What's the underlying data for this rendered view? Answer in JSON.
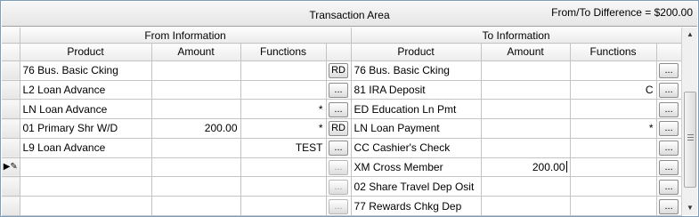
{
  "caption": {
    "title": "Transaction Area",
    "difference": "From/To Difference = $200.00"
  },
  "groups": {
    "from": "From Information",
    "to": "To Information"
  },
  "columns": {
    "product": "Product",
    "amount": "Amount",
    "functions": "Functions"
  },
  "icons": {
    "edit_row_indicator": "pencil-icon",
    "scroll_up": "arrow-up-icon",
    "scroll_down": "arrow-down-icon"
  },
  "rows": [
    {
      "from_product": "76 Bus. Basic Cking",
      "from_amount": "",
      "from_functions": "",
      "from_btn": "RD",
      "to_product": "76 Bus. Basic Cking",
      "to_amount": "",
      "to_functions": "",
      "to_btn": "..."
    },
    {
      "from_product": "L2 Loan Advance",
      "from_amount": "",
      "from_functions": "",
      "from_btn": "...",
      "to_product": "81 IRA Deposit",
      "to_amount": "",
      "to_functions": "C",
      "to_btn": "..."
    },
    {
      "from_product": "LN Loan Advance",
      "from_amount": "",
      "from_functions": "*",
      "from_btn": "...",
      "to_product": "ED Education Ln Pmt",
      "to_amount": "",
      "to_functions": "",
      "to_btn": "..."
    },
    {
      "from_product": "01 Primary Shr W/D",
      "from_amount": "200.00",
      "from_functions": "*",
      "from_btn": "RD",
      "to_product": "LN Loan Payment",
      "to_amount": "",
      "to_functions": "*",
      "to_btn": "..."
    },
    {
      "from_product": "L9 Loan Advance",
      "from_amount": "",
      "from_functions": "TEST",
      "from_btn": "...",
      "to_product": "CC Cashier's Check",
      "to_amount": "",
      "to_functions": "",
      "to_btn": "..."
    },
    {
      "from_product": "",
      "from_amount": "",
      "from_functions": "",
      "from_btn": "...",
      "to_product": "XM Cross Member",
      "to_amount": "200.00",
      "to_functions": "",
      "to_btn": "..."
    },
    {
      "from_product": "",
      "from_amount": "",
      "from_functions": "",
      "from_btn": "...",
      "to_product": "02 Share Travel Dep Osit",
      "to_amount": "",
      "to_functions": "",
      "to_btn": "..."
    },
    {
      "from_product": "",
      "from_amount": "",
      "from_functions": "",
      "from_btn": "...",
      "to_product": "77 Rewards Chkg Dep",
      "to_amount": "",
      "to_functions": "",
      "to_btn": "..."
    }
  ]
}
